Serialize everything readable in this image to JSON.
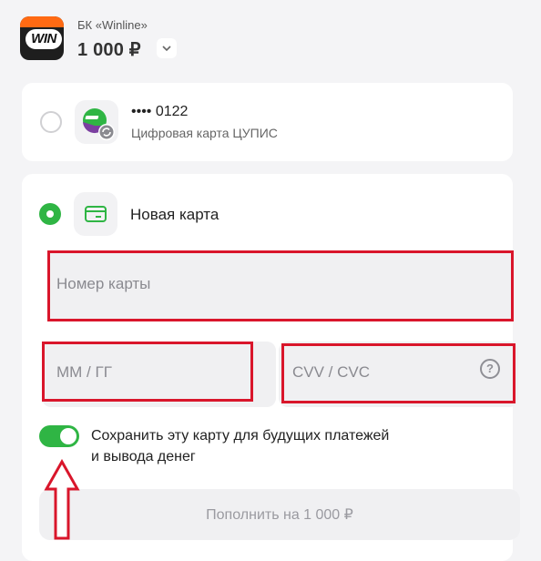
{
  "header": {
    "logo_text": "WIN",
    "merchant": "БК «Winline»",
    "amount": "1 000 ₽"
  },
  "saved_card": {
    "masked_number": "•••• 0122",
    "description": "Цифровая карта ЦУПИС",
    "selected": false
  },
  "new_card": {
    "label": "Новая карта",
    "selected": true,
    "card_number_placeholder": "Номер карты",
    "expiry_placeholder": "ММ / ГГ",
    "cvv_placeholder": "CVV / CVC",
    "help_symbol": "?"
  },
  "save_option": {
    "enabled": true,
    "label_line1": "Сохранить эту карту для будущих платежей",
    "label_line2": "и вывода денег"
  },
  "submit_button": {
    "label": "Пополнить на 1 000 ₽"
  },
  "colors": {
    "accent_green": "#2fb544",
    "annotation_red": "#d9162b",
    "brand_orange": "#ff6a13"
  }
}
